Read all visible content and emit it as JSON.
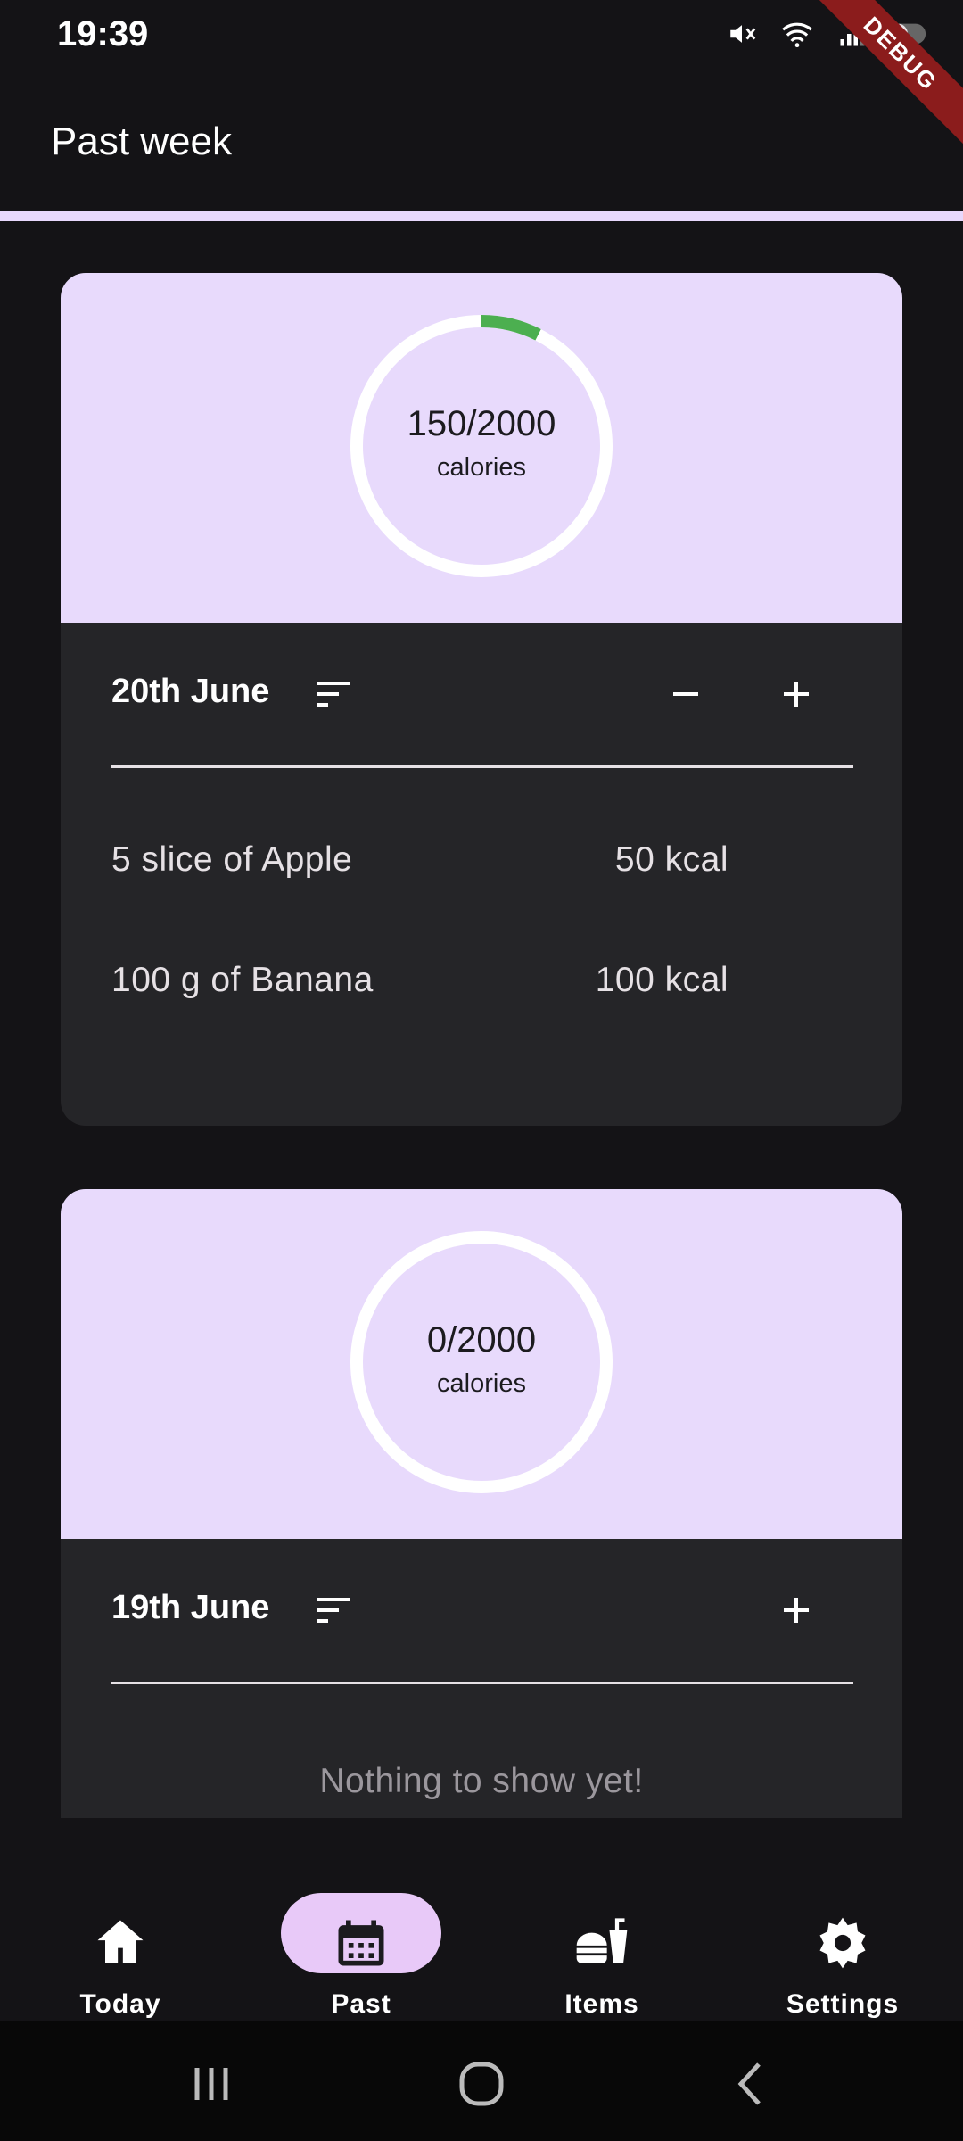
{
  "status_bar": {
    "time": "19:39",
    "icons": [
      "mute-icon",
      "wifi-icon",
      "signal-icon",
      "battery-icon"
    ],
    "debug_label": "DEBUG"
  },
  "app_bar": {
    "title": "Past week"
  },
  "days": [
    {
      "date": "20th June",
      "calories_text": "150/2000",
      "calories_label": "calories",
      "progress": 0.075,
      "entries": [
        {
          "name": "5 slice of Apple",
          "kcal": "50 kcal"
        },
        {
          "name": "100 g of Banana",
          "kcal": "100 kcal"
        }
      ]
    },
    {
      "date": "19th June",
      "calories_text": "0/2000",
      "calories_label": "calories",
      "progress": 0,
      "empty_message": "Nothing to show yet!"
    }
  ],
  "bottom_nav": [
    {
      "label": "Today",
      "icon": "home-icon",
      "active": false
    },
    {
      "label": "Past",
      "icon": "calendar-icon",
      "active": true
    },
    {
      "label": "Items",
      "icon": "food-icon",
      "active": false
    },
    {
      "label": "Settings",
      "icon": "gear-icon",
      "active": false
    }
  ],
  "colors": {
    "accent": "#e8dafc",
    "progress_green": "#4caf50",
    "active_pill": "#e8c9f8",
    "card_bg": "#252528",
    "background": "#141316"
  }
}
